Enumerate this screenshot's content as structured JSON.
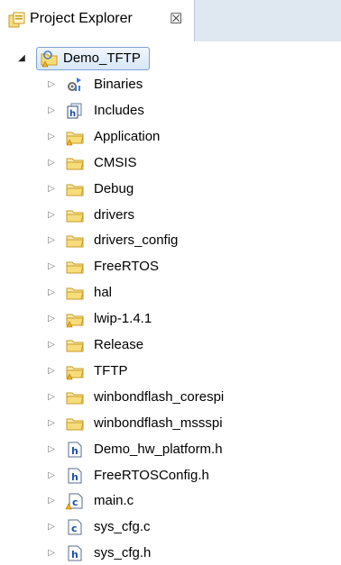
{
  "tab": {
    "title": "Project Explorer",
    "close_glyph": "☒",
    "icon": "project-explorer-icon"
  },
  "tree": {
    "root": {
      "label": "Demo_TFTP",
      "icon": "project-folder-warning-icon",
      "expanded": true
    },
    "items": [
      {
        "label": "Binaries",
        "icon": "binaries-icon"
      },
      {
        "label": "Includes",
        "icon": "includes-icon"
      },
      {
        "label": "Application",
        "icon": "folder-warning-icon"
      },
      {
        "label": "CMSIS",
        "icon": "folder-icon"
      },
      {
        "label": "Debug",
        "icon": "folder-icon"
      },
      {
        "label": "drivers",
        "icon": "folder-icon"
      },
      {
        "label": "drivers_config",
        "icon": "folder-icon"
      },
      {
        "label": "FreeRTOS",
        "icon": "folder-icon"
      },
      {
        "label": "hal",
        "icon": "folder-icon"
      },
      {
        "label": "lwip-1.4.1",
        "icon": "folder-warning-icon"
      },
      {
        "label": "Release",
        "icon": "folder-icon"
      },
      {
        "label": "TFTP",
        "icon": "folder-warning-icon"
      },
      {
        "label": "winbondflash_corespi",
        "icon": "folder-icon"
      },
      {
        "label": "winbondflash_mssspi",
        "icon": "folder-icon"
      },
      {
        "label": "Demo_hw_platform.h",
        "icon": "header-file-icon"
      },
      {
        "label": "FreeRTOSConfig.h",
        "icon": "header-file-icon"
      },
      {
        "label": "main.c",
        "icon": "c-file-warning-icon"
      },
      {
        "label": "sys_cfg.c",
        "icon": "c-file-icon"
      },
      {
        "label": "sys_cfg.h",
        "icon": "header-file-icon"
      }
    ]
  },
  "colors": {
    "folder_fill": "#f7dc7a",
    "folder_stroke": "#c89b2a",
    "warning": "#f2b21b",
    "selection_border": "#7da2ce",
    "tabbar_bg": "#dfe7f1"
  }
}
